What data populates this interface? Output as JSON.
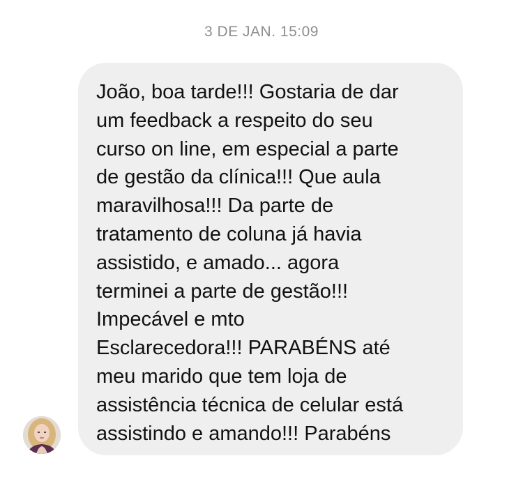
{
  "conversation": {
    "timestamp": "3 DE JAN. 15:09",
    "message": {
      "sender_avatar_icon": "user-avatar-photo",
      "text": "João, boa tarde!!! Gostaria de dar\num feedback a respeito do seu\ncurso on line, em especial a parte\nde gestão da clínica!!! Que aula\nmaravilhosa!!! Da parte de\ntratamento de coluna já havia\nassistido, e amado... agora\nterminei a parte de gestão!!!\nImpecável e mto\nEsclarecedora!!! PARABÉNS até\nmeu marido que tem loja de\nassistência técnica de celular está\nassistindo e amando!!! Parabéns"
    }
  },
  "colors": {
    "bubble_background": "#efefef",
    "timestamp_text": "#8e8e93",
    "message_text": "#111111",
    "page_background": "#ffffff"
  }
}
